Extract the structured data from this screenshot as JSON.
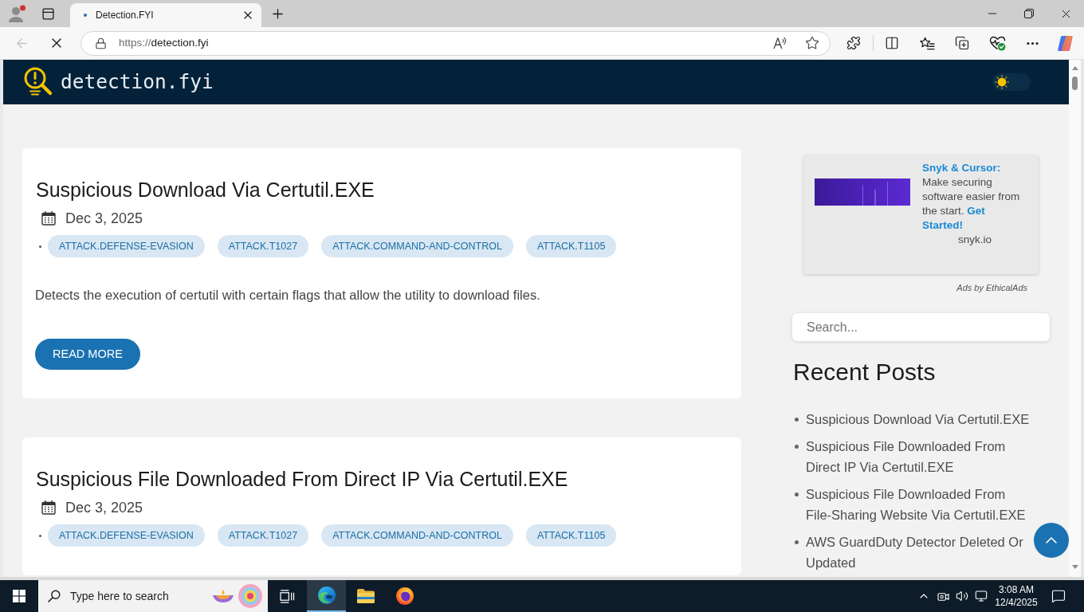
{
  "browser": {
    "tabs": [
      {
        "title": "Detection.FYI",
        "selected": true
      }
    ],
    "back_disabled": true,
    "loading": true,
    "url": {
      "scheme": "https://",
      "host": "detection.fyi"
    }
  },
  "site": {
    "logo_text": "detection.fyi",
    "dark_mode": false
  },
  "posts": [
    {
      "title": "Suspicious Download Via Certutil.EXE",
      "date": "Dec 3, 2025",
      "tags": [
        "ATTACK.DEFENSE-EVASION",
        "ATTACK.T1027",
        "ATTACK.COMMAND-AND-CONTROL",
        "ATTACK.T1105"
      ],
      "description": "Detects the execution of certutil with certain flags that allow the utility to download files.",
      "button": "READ MORE"
    },
    {
      "title": "Suspicious File Downloaded From Direct IP Via Certutil.EXE",
      "date": "Dec 3, 2025",
      "tags": [
        "ATTACK.DEFENSE-EVASION",
        "ATTACK.T1027",
        "ATTACK.COMMAND-AND-CONTROL",
        "ATTACK.T1105"
      ]
    }
  ],
  "sidebar": {
    "ad": {
      "text": "**Snyk & Cursor:** Make securing software easier from the start. **Get Started!**",
      "domain": "snyk.io",
      "credit": "Ads by EthicalAds"
    },
    "search": {
      "placeholder": "Search..."
    },
    "recent_posts": {
      "title": "Recent Posts",
      "items": [
        "Suspicious Download Via Certutil.EXE",
        "Suspicious File Downloaded From Direct IP Via Certutil.EXE",
        "Suspicious File Downloaded From File-Sharing Website Via Certutil.EXE",
        "AWS GuardDuty Detector Deleted Or Updated"
      ]
    }
  },
  "taskbar": {
    "search_placeholder": "Type here to search",
    "apps": [
      {
        "kind": "task-view",
        "selected": false
      },
      {
        "kind": "swirl",
        "selected": true
      },
      {
        "kind": "folder",
        "selected": false
      },
      {
        "kind": "fox",
        "selected": false
      }
    ],
    "time": "3:08 AM",
    "date": "12/4/2025"
  }
}
